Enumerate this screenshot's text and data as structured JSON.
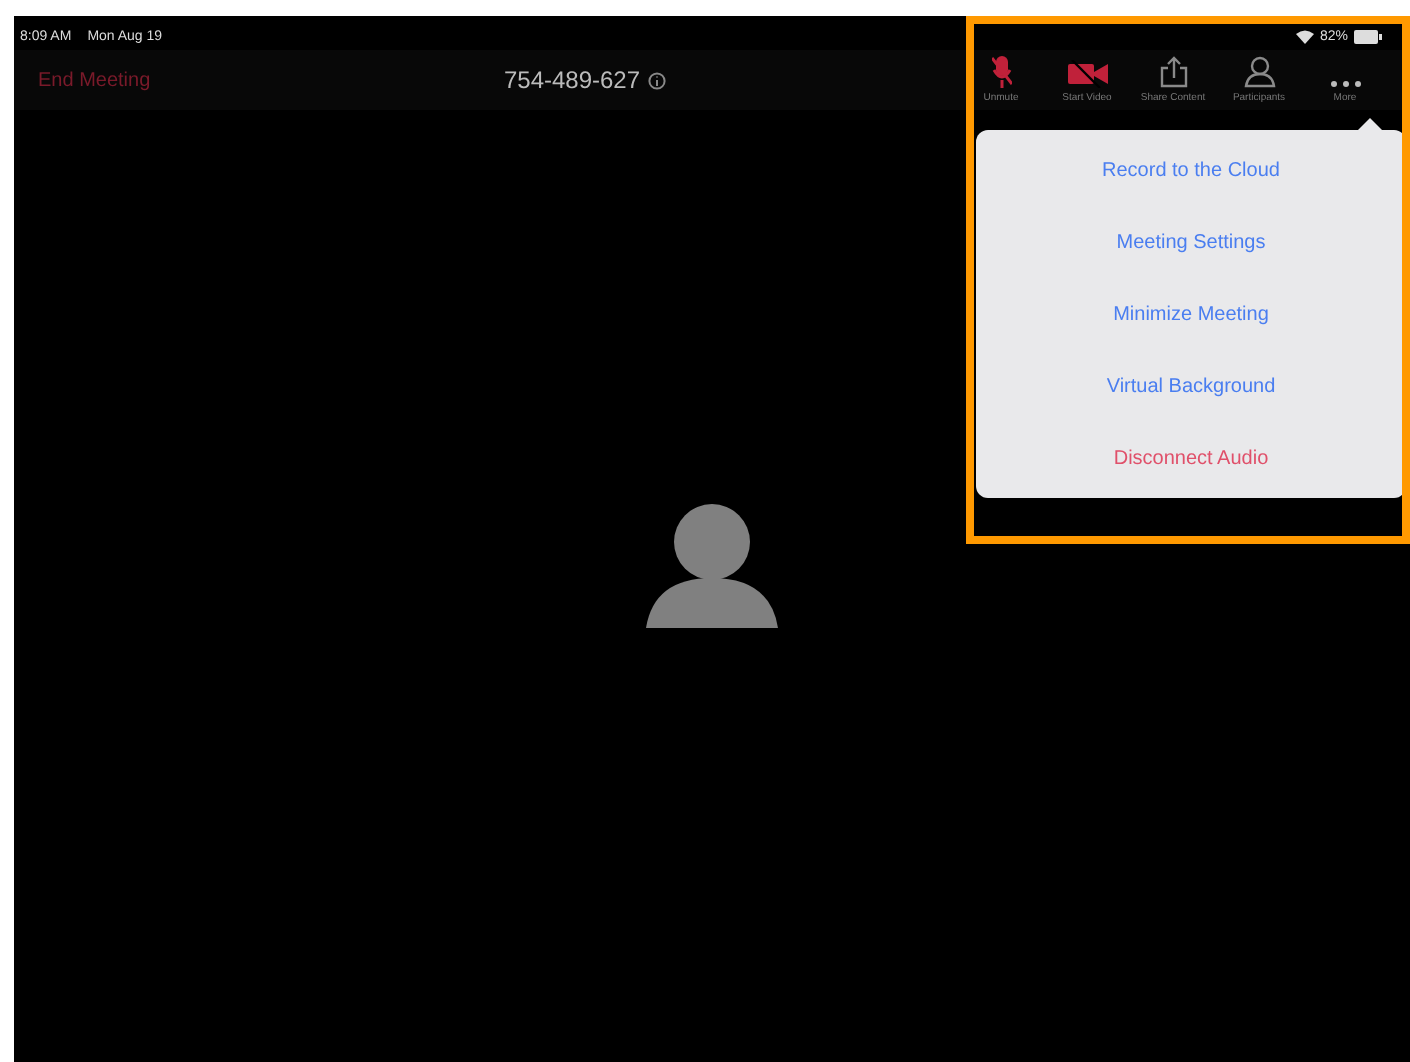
{
  "status_bar": {
    "time": "8:09 AM",
    "date": "Mon Aug 19",
    "battery": "82%"
  },
  "top_bar": {
    "end_button": "End Meeting",
    "meeting_id": "754-489-627"
  },
  "toolbar": [
    {
      "label": "Unmute",
      "kind": "mic"
    },
    {
      "label": "Start Video",
      "kind": "video"
    },
    {
      "label": "Share Content",
      "kind": "share"
    },
    {
      "label": "Participants",
      "kind": "participants"
    },
    {
      "label": "More",
      "kind": "more"
    }
  ],
  "more_menu": [
    {
      "label": "Record to the Cloud",
      "kind": "normal"
    },
    {
      "label": "Meeting Settings",
      "kind": "normal"
    },
    {
      "label": "Minimize Meeting",
      "kind": "normal"
    },
    {
      "label": "Virtual Background",
      "kind": "normal"
    },
    {
      "label": "Disconnect Audio",
      "kind": "destructive"
    }
  ]
}
